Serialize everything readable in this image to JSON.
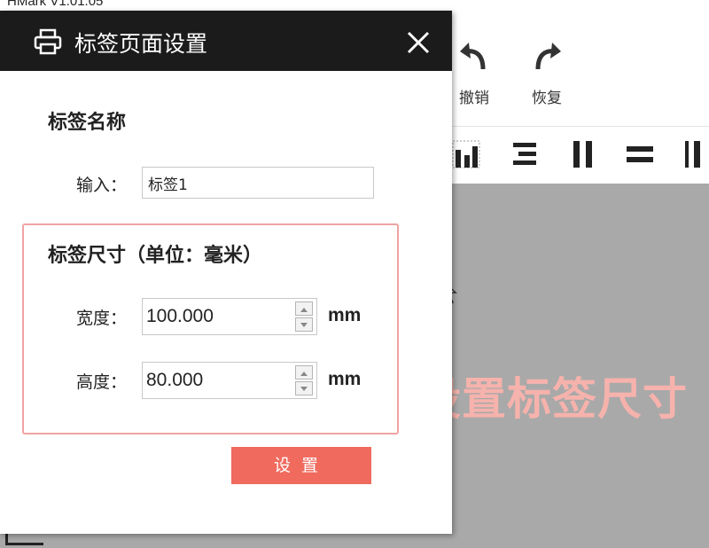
{
  "app": {
    "title": "HMark V1.01.05",
    "toolbar": {
      "undo_label": "撤销",
      "redo_label": "恢复"
    }
  },
  "dialog": {
    "title": "标签页面设置",
    "name_section": {
      "heading": "标签名称",
      "input_label": "输入：",
      "input_value": "标签1"
    },
    "size_section": {
      "heading": "标签尺寸（单位：毫米）",
      "width_label": "宽度：",
      "width_value": "100.000",
      "width_unit": "mm",
      "height_label": "高度：",
      "height_value": "80.000",
      "height_unit": "mm"
    },
    "set_button_label": "设置"
  },
  "overlay_caption": "设置标签尺寸",
  "colors": {
    "dialog_header": "#1b1b1b",
    "set_button": "#f06a5e",
    "size_box_border": "#f0a3a3",
    "overlay_caption": "#f6b2ac",
    "canvas_gray": "#a9a9a9"
  },
  "icons": {
    "dialog": "printer-icon",
    "close": "close-icon",
    "undo": "undo-arrow-icon",
    "redo": "redo-arrow-icon"
  }
}
